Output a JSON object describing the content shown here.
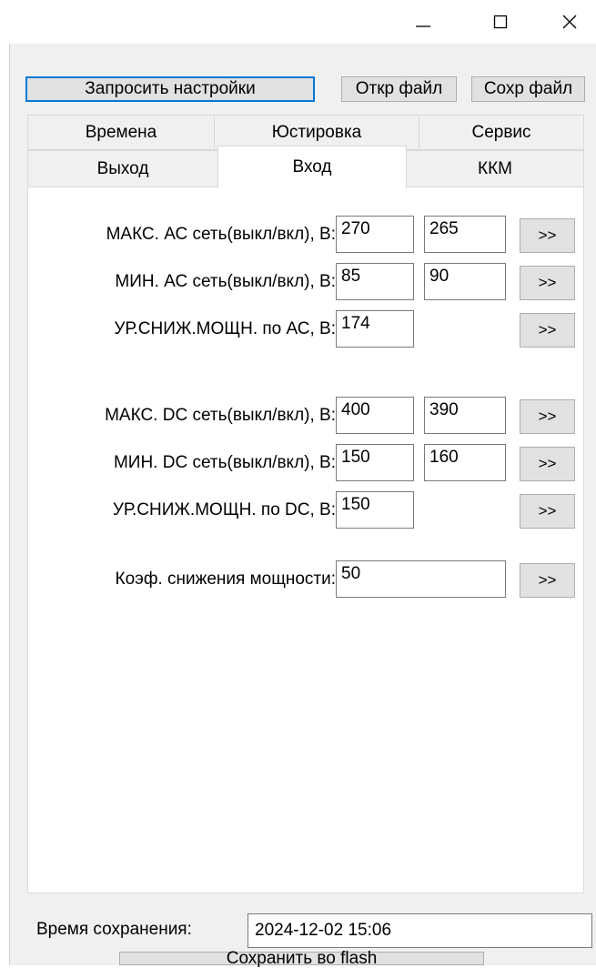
{
  "titlebar": {
    "minimize_icon": "minimize-icon",
    "maximize_icon": "maximize-icon",
    "close_icon": "close-icon"
  },
  "toolbar": {
    "request_settings": "Запросить настройки",
    "open_file": "Откр файл",
    "save_file": "Сохр файл"
  },
  "tabs_row1": [
    "Времена",
    "Юстировка",
    "Сервис"
  ],
  "tabs_row2": [
    "Выход",
    "Вход",
    "ККМ"
  ],
  "active_tab": "Вход",
  "input_panel": {
    "go_label": ">>",
    "rows": [
      {
        "label": "МАКС. АС сеть(выкл/вкл), В:",
        "value1": "270",
        "value2": "265"
      },
      {
        "label": "МИН. АС сеть(выкл/вкл), В:",
        "value1": "85",
        "value2": "90"
      },
      {
        "label": "УР.СНИЖ.МОЩН. по АС, В:",
        "value1": "174"
      },
      {
        "label": "МАКС. DC сеть(выкл/вкл), В:",
        "value1": "400",
        "value2": "390"
      },
      {
        "label": "МИН. DC сеть(выкл/вкл), В:",
        "value1": "150",
        "value2": "160"
      },
      {
        "label": "УР.СНИЖ.МОЩН. по DC, В:",
        "value1": "150"
      },
      {
        "label": "Коэф. снижения мощности:",
        "value1": "50"
      }
    ]
  },
  "footer": {
    "save_time_label": "Время сохранения:",
    "save_time_value": "2024-12-02 15:06",
    "save_flash_button": "Сохранить во flash"
  }
}
